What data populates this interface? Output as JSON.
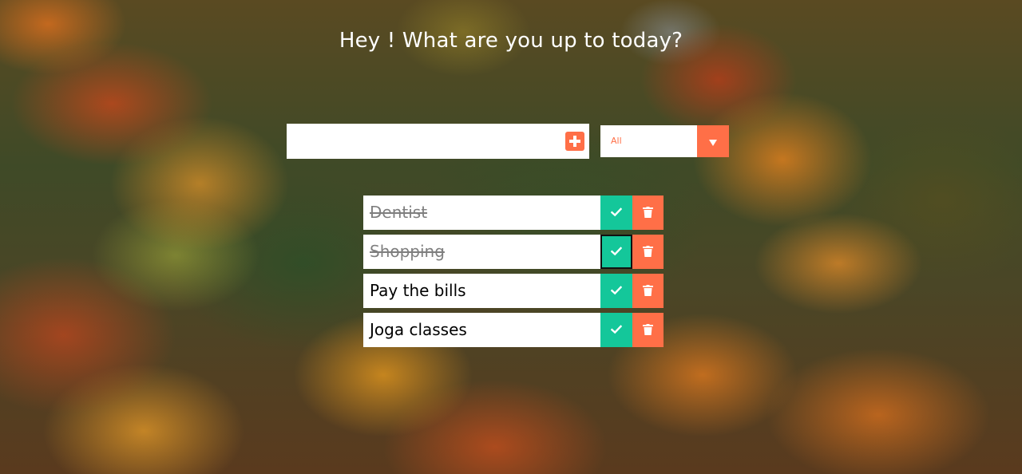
{
  "header": {
    "title": "Hey ! What are you up to today?"
  },
  "form": {
    "input_value": "",
    "add_icon": "plus-icon",
    "filter": {
      "selected": "All",
      "arrow_icon": "chevron-down-icon"
    }
  },
  "todos": [
    {
      "text": "Dentist",
      "completed": true
    },
    {
      "text": "Shopping",
      "completed": true
    },
    {
      "text": "Pay the bills",
      "completed": false
    },
    {
      "text": "Joga classes",
      "completed": false
    }
  ],
  "icons": {
    "complete": "check-icon",
    "delete": "trash-icon"
  },
  "colors": {
    "accent": "#ff6f47",
    "complete": "#14c79a",
    "surface": "#ffffff"
  }
}
